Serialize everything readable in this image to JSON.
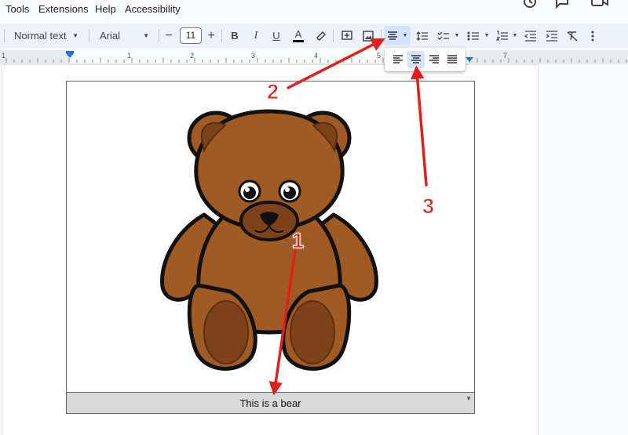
{
  "menu": [
    "Tools",
    "Extensions",
    "Help",
    "Accessibility"
  ],
  "toolbar": {
    "paragraph_style": "Normal text",
    "font": "Arial",
    "font_size": "11",
    "minus": "−",
    "plus": "+",
    "bold": "B",
    "italic": "I",
    "underline": "U",
    "text_color": "A"
  },
  "ruler": {
    "marks": [
      "1",
      "1",
      "2",
      "3",
      "4",
      "5",
      "6",
      "7"
    ]
  },
  "caption": "This is a bear",
  "annotations": [
    "1",
    "2",
    "3"
  ],
  "colors": {
    "accent": "#d3e3fd",
    "annotation": "#e0211b",
    "toolbar_bg": "#edf2fa",
    "bear": "#a05a24",
    "bear_dark": "#7d4219"
  }
}
